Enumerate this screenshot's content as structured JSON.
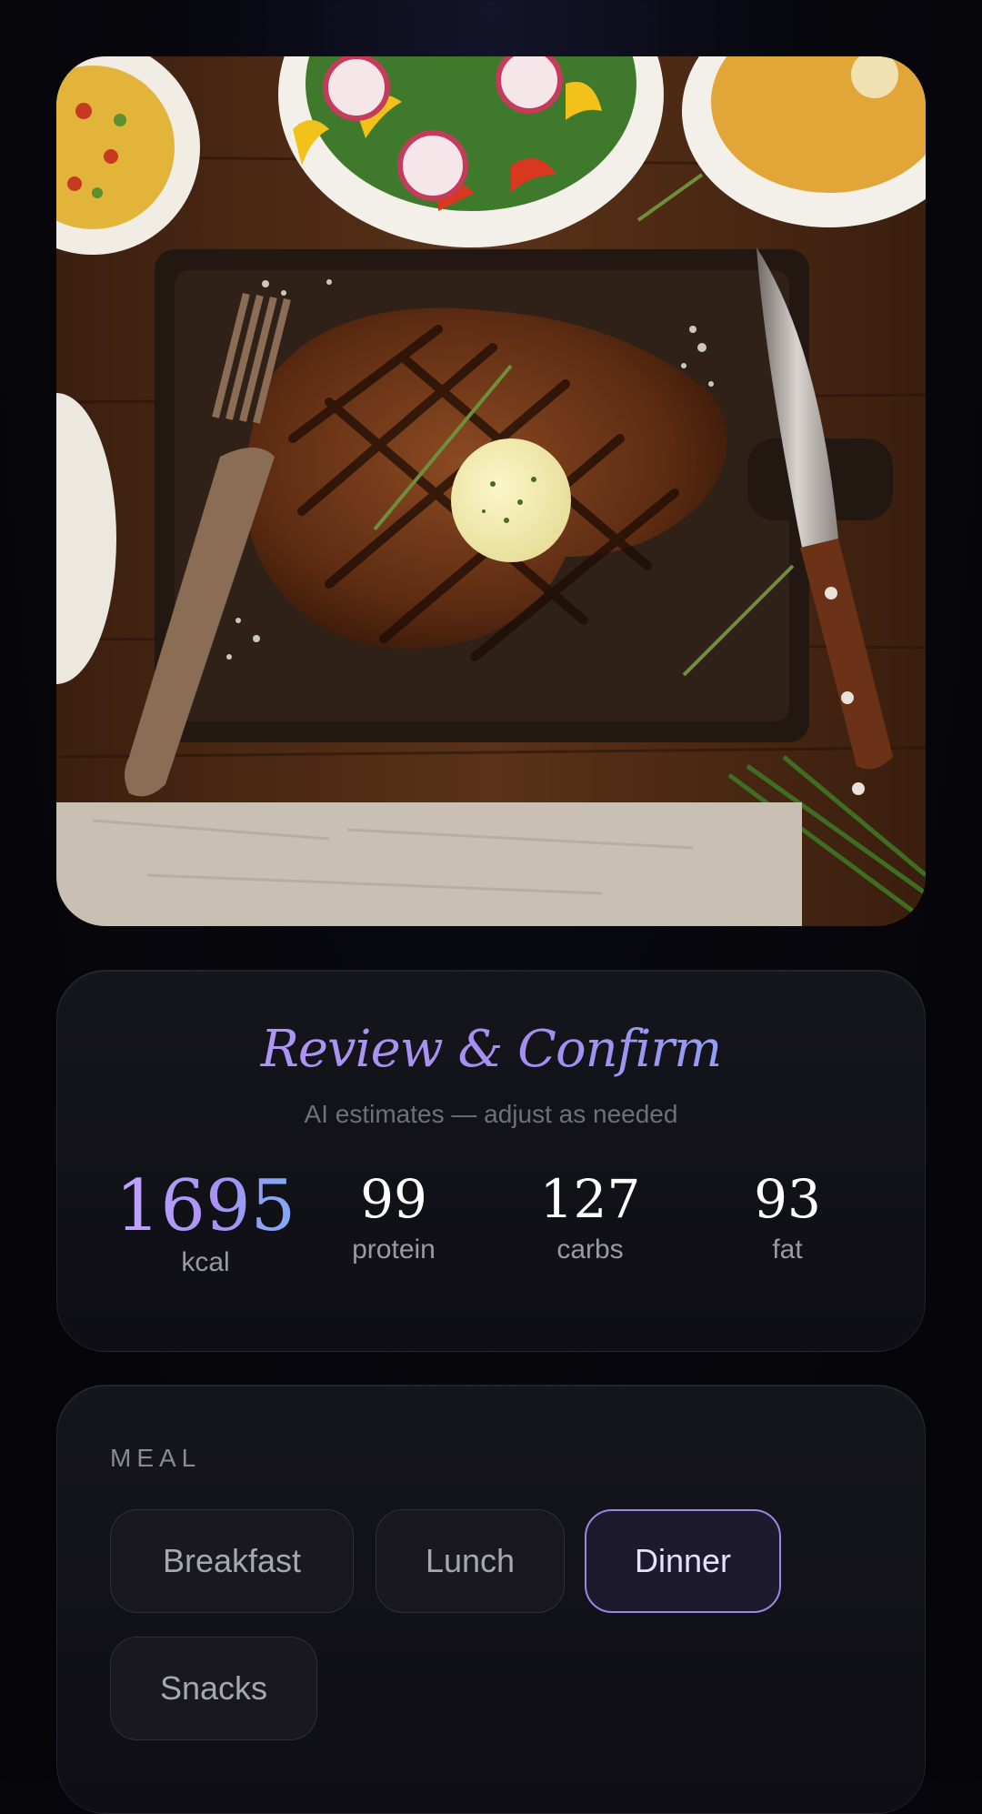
{
  "photo": {
    "alt_icon": "food-photo"
  },
  "review": {
    "title": "Review & Confirm",
    "subtitle": "AI estimates — adjust as needed",
    "stats": {
      "kcal": {
        "value": "1695",
        "label": "kcal"
      },
      "protein": {
        "value": "99",
        "label": "protein"
      },
      "carbs": {
        "value": "127",
        "label": "carbs"
      },
      "fat": {
        "value": "93",
        "label": "fat"
      }
    }
  },
  "meal": {
    "label": "MEAL",
    "options": [
      "Breakfast",
      "Lunch",
      "Dinner",
      "Snacks"
    ],
    "selected": "Dinner"
  },
  "colors": {
    "background": "#07070d",
    "accent_purple": "#a892f5",
    "accent_blue": "#79aef7",
    "selected_border": "#9b87e8"
  }
}
